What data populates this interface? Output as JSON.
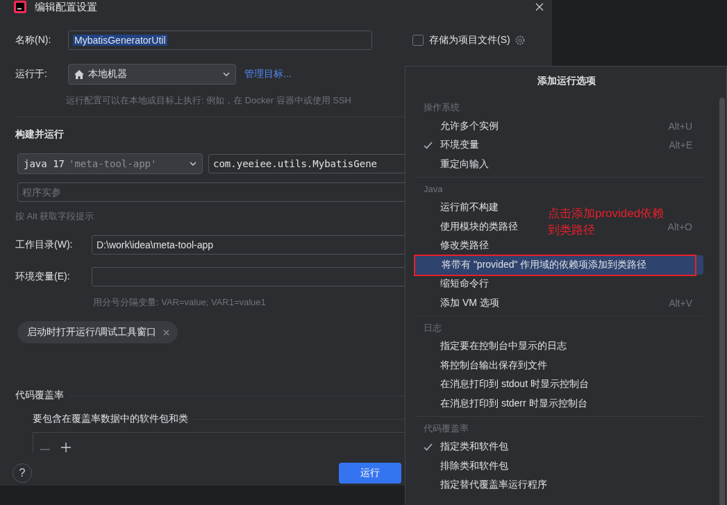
{
  "window": {
    "title": "编辑配置设置"
  },
  "name_field": {
    "label": "名称(N):",
    "value": "MybatisGeneratorUtil"
  },
  "store_as_project_file": {
    "label": "存储为项目文件(S)",
    "checked": false
  },
  "run_on": {
    "label": "运行于:",
    "value": "本地机器",
    "link": "管理目标...",
    "hint": "运行配置可以在本地或目标上执行: 例如，在 Docker 容器中或使用 SSH"
  },
  "build_and_run": {
    "title": "构建并运行",
    "jdk": {
      "name": "java 17",
      "module": "'meta-tool-app'"
    },
    "main_class": "com.yeeiee.utils.MybatisGene",
    "program_args": {
      "placeholder": "程序实参"
    },
    "hint": "按 Alt 获取字段提示"
  },
  "working_dir": {
    "label": "工作目录(W):",
    "value": "D:\\work\\idea\\meta-tool-app"
  },
  "env_vars": {
    "label": "环境变量(E):",
    "hint": "用分号分隔变量: VAR=value; VAR1=value1"
  },
  "tags": [
    "启动时打开运行/调试工具窗口"
  ],
  "coverage": {
    "title": "代码覆盖率",
    "subtitle": "要包含在覆盖率数据中的软件包和类"
  },
  "footer": {
    "help": "?",
    "run_button": "运行"
  },
  "menu": {
    "title": "添加运行选项",
    "sections": [
      {
        "header": "操作系统",
        "items": [
          {
            "label": "允许多个实例",
            "checked": false,
            "shortcut": "Alt+U",
            "selected": false
          },
          {
            "label": "环境变量",
            "checked": true,
            "shortcut": "Alt+E",
            "selected": false
          },
          {
            "label": "重定向输入",
            "checked": false,
            "selected": false
          }
        ]
      },
      {
        "header": "Java",
        "items": [
          {
            "label": "运行前不构建",
            "checked": false,
            "selected": false
          },
          {
            "label": "使用模块的类路径",
            "checked": false,
            "shortcut": "Alt+O",
            "selected": false
          },
          {
            "label": "修改类路径",
            "checked": false,
            "selected": false
          },
          {
            "label": "将带有 \"provided\" 作用域的依赖项添加到类路径",
            "checked": false,
            "selected": true
          },
          {
            "label": "缩短命令行",
            "checked": false,
            "selected": false
          },
          {
            "label": "添加 VM 选项",
            "checked": false,
            "shortcut": "Alt+V",
            "selected": false
          }
        ]
      },
      {
        "header": "日志",
        "items": [
          {
            "label": "指定要在控制台中显示的日志",
            "checked": false,
            "selected": false
          },
          {
            "label": "将控制台输出保存到文件",
            "checked": false,
            "selected": false
          },
          {
            "label": "在消息打印到 stdout 时显示控制台",
            "checked": false,
            "selected": false
          },
          {
            "label": "在消息打印到 stderr 时显示控制台",
            "checked": false,
            "selected": false
          }
        ]
      },
      {
        "header": "代码覆盖率",
        "items": [
          {
            "label": "指定类和软件包",
            "checked": true,
            "selected": false
          },
          {
            "label": "排除类和软件包",
            "checked": false,
            "selected": false
          },
          {
            "label": "指定替代覆盖率运行程序",
            "checked": false,
            "selected": false
          }
        ]
      }
    ]
  },
  "annotation": {
    "lines": [
      "点击添加provided依赖",
      "到类路径"
    ]
  }
}
